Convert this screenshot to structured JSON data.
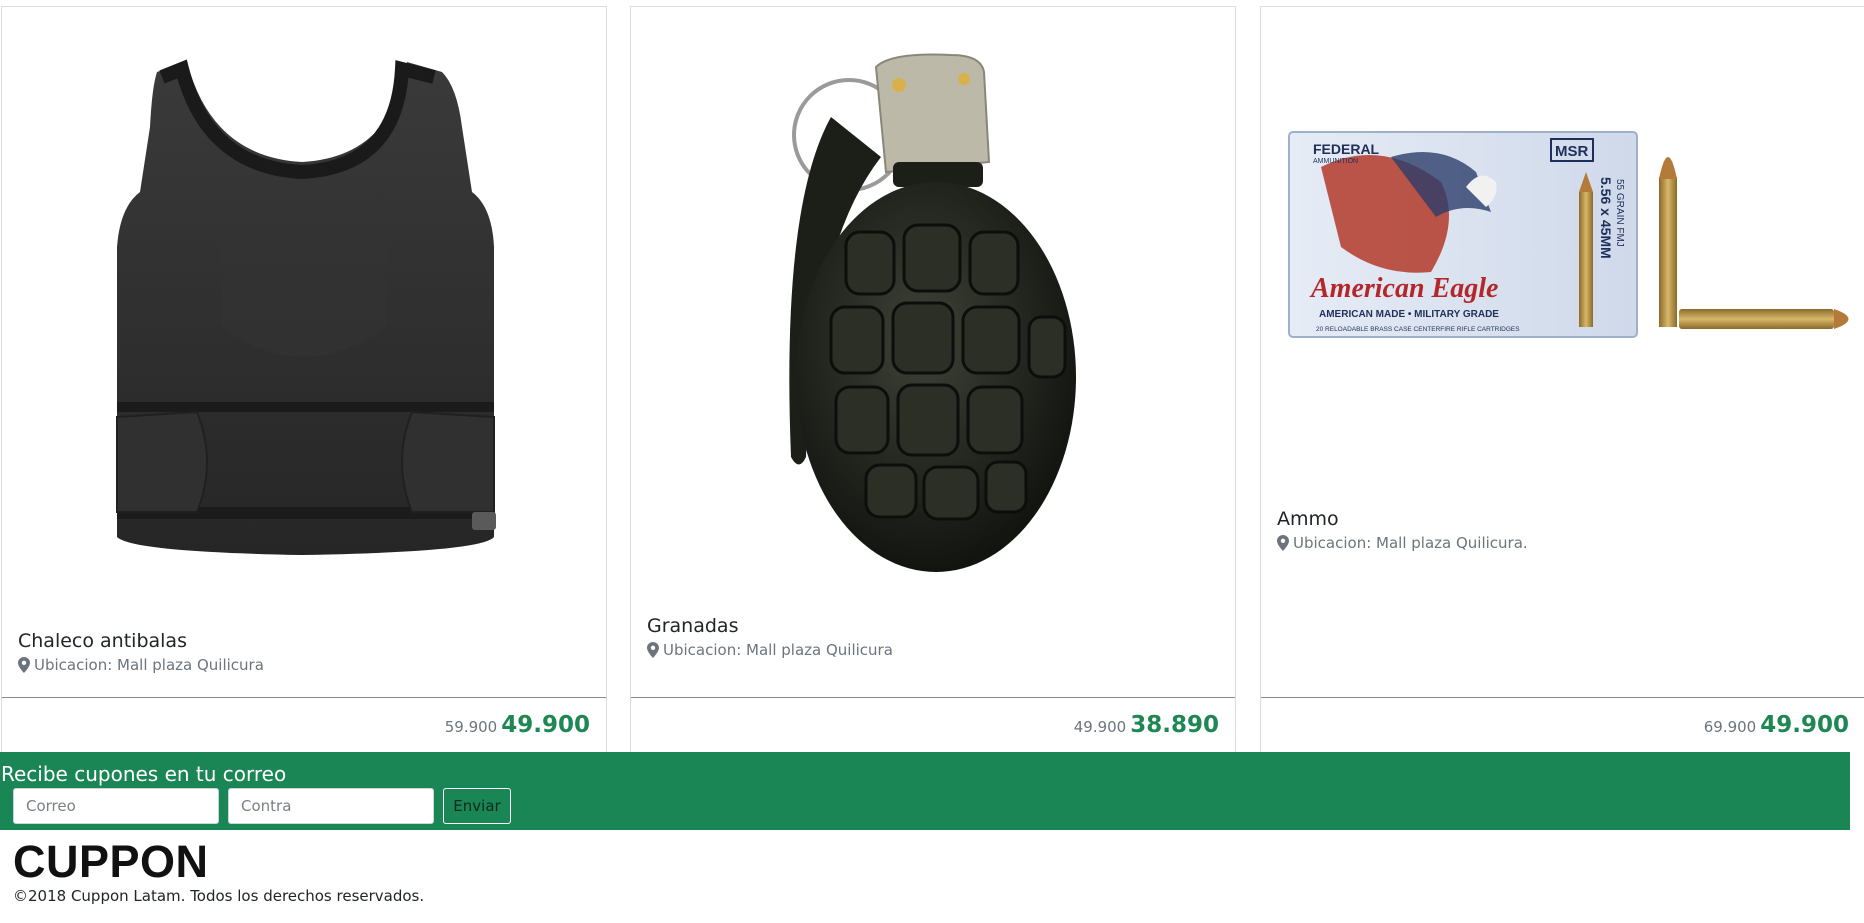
{
  "products": [
    {
      "title": "Chaleco antibalas",
      "location": "Ubicacion: Mall plaza Quilicura",
      "price_old": "59.900",
      "price_new": "49.900",
      "image": "bulletproof-vest-image"
    },
    {
      "title": "Granadas",
      "location": "Ubicacion: Mall plaza Quilicura",
      "price_old": "49.900",
      "price_new": "38.890",
      "image": "hand-grenade-image"
    },
    {
      "title": "Ammo",
      "location": "Ubicacion: Mall plaza Quilicura.",
      "price_old": "69.900",
      "price_new": "49.900",
      "image": "ammunition-box-image",
      "ammo_box": {
        "brand": "FEDERAL",
        "brand_sub": "AMMUNITION",
        "badge": "MSR",
        "name": "American Eagle",
        "tagline": "AMERICAN MADE • MILITARY GRADE",
        "caliber": "5.56 x 45MM",
        "grain": "55 GRAIN FMJ",
        "footnote": "20 RELOADABLE BRASS CASE CENTERFIRE RIFLE CARTRIDGES"
      }
    }
  ],
  "newsletter": {
    "title": "Recibe cupones en tu correo",
    "email_placeholder": "Correo",
    "password_placeholder": "Contra",
    "submit_label": "Enviar"
  },
  "footer": {
    "brand": "CUPPON",
    "copyright": "©2018 Cuppon Latam. Todos los derechos reservados."
  },
  "colors": {
    "accent": "#1b8655",
    "price": "#1e8753",
    "muted": "#6c757d"
  }
}
